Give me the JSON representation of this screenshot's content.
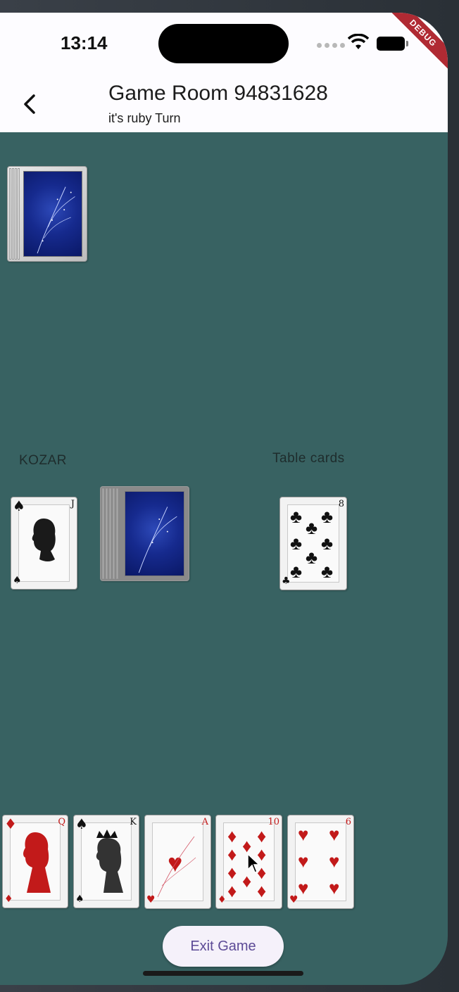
{
  "status_bar": {
    "time": "13:14",
    "debug_label": "DEBUG"
  },
  "app_bar": {
    "title": "Game Room 94831628",
    "subtitle": "it's ruby Turn"
  },
  "labels": {
    "trump": "KOZAR",
    "table": "Table cards"
  },
  "trump_card": {
    "rank": "J",
    "suit": "♠",
    "suit_name": "spades"
  },
  "table_card": {
    "rank": "8",
    "suit": "♣",
    "suit_name": "clubs"
  },
  "hand": [
    {
      "rank": "Q",
      "suit": "♦",
      "color": "red"
    },
    {
      "rank": "K",
      "suit": "♠",
      "color": "black"
    },
    {
      "rank": "A",
      "suit": "♥",
      "color": "red"
    },
    {
      "rank": "10",
      "suit": "♦",
      "color": "red"
    },
    {
      "rank": "6",
      "suit": "♥",
      "color": "red"
    }
  ],
  "exit_button": {
    "label": "Exit Game"
  },
  "colors": {
    "table_felt": "#386262",
    "app_bar_bg": "#fdfcff",
    "button_text": "#5c4a96",
    "debug_ribbon": "#b02a33"
  }
}
